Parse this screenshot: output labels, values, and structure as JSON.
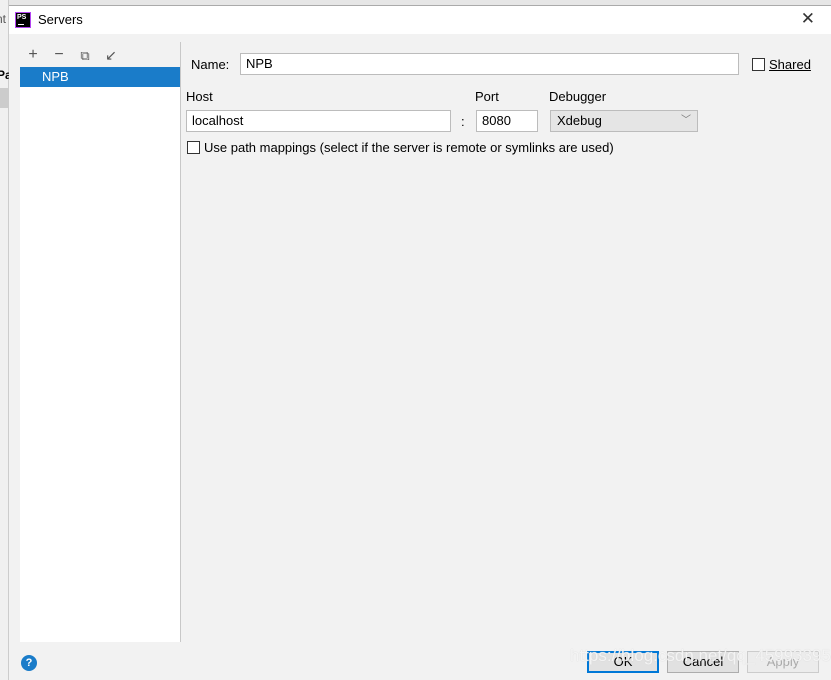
{
  "background_app": {
    "text1": "nt",
    "text2": "Pa"
  },
  "window": {
    "title": "Servers",
    "logo": "PS"
  },
  "toolbar": {
    "icons": [
      "plus-icon",
      "minus-icon",
      "copy-icon",
      "import-icon"
    ]
  },
  "servers": [
    {
      "label": "NPB",
      "selected": true
    }
  ],
  "form": {
    "name_label": "Name:",
    "name_value": "NPB",
    "shared_label": "Shared",
    "shared_checked": false,
    "host_label": "Host",
    "host_value": "localhost",
    "colon": ":",
    "port_label": "Port",
    "port_value": "8080",
    "debugger_label": "Debugger",
    "debugger_value": "Xdebug",
    "path_mappings_label": "Use path mappings (select if the server is remote or symlinks are used)",
    "path_mappings_checked": false
  },
  "footer": {
    "help": "?",
    "ok": "OK",
    "cancel": "Cancel",
    "apply": "Apply"
  },
  "watermark": "https://blog.csdn.net/qq_45...395",
  "colors": {
    "accent": "#1a7cc9",
    "default_button_border": "#0078d7"
  }
}
